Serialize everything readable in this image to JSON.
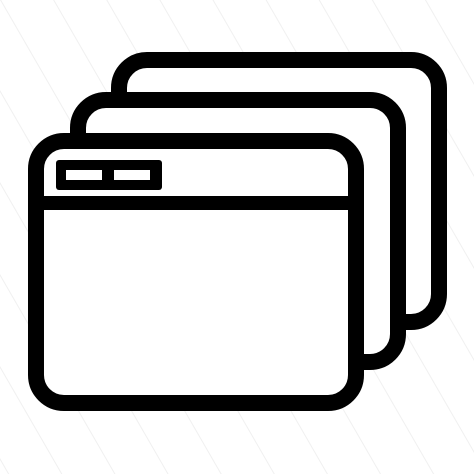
{
  "icon": {
    "name": "windows-stack-icon",
    "stroke_color": "#000000",
    "fill_color": "#ffffff",
    "window_count": 3,
    "title_buttons": 2
  },
  "background": {
    "color": "#ffffff",
    "pattern": "diagonal-lines",
    "pattern_color": "#f0f0f0"
  }
}
